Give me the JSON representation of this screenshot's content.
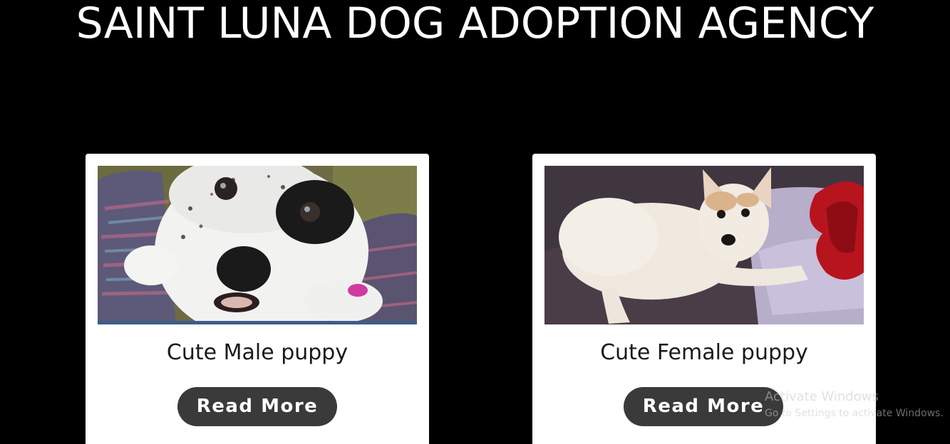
{
  "header": {
    "title": "SAINT LUNA DOG ADOPTION AGENCY"
  },
  "cards": [
    {
      "title": "Cute Male puppy",
      "button_label": "Read More",
      "image": "black-and-white-puppy-photo"
    },
    {
      "title": "Cute Female puppy",
      "button_label": "Read More",
      "image": "white-dog-lying-on-bed-photo"
    }
  ],
  "watermark": {
    "title": "Activate Windows",
    "subtitle": "Go to Settings to activate Windows."
  },
  "colors": {
    "background": "#000000",
    "card": "#ffffff",
    "button": "#3a3a3a",
    "button_text": "#ffffff",
    "title_text": "#ffffff"
  }
}
